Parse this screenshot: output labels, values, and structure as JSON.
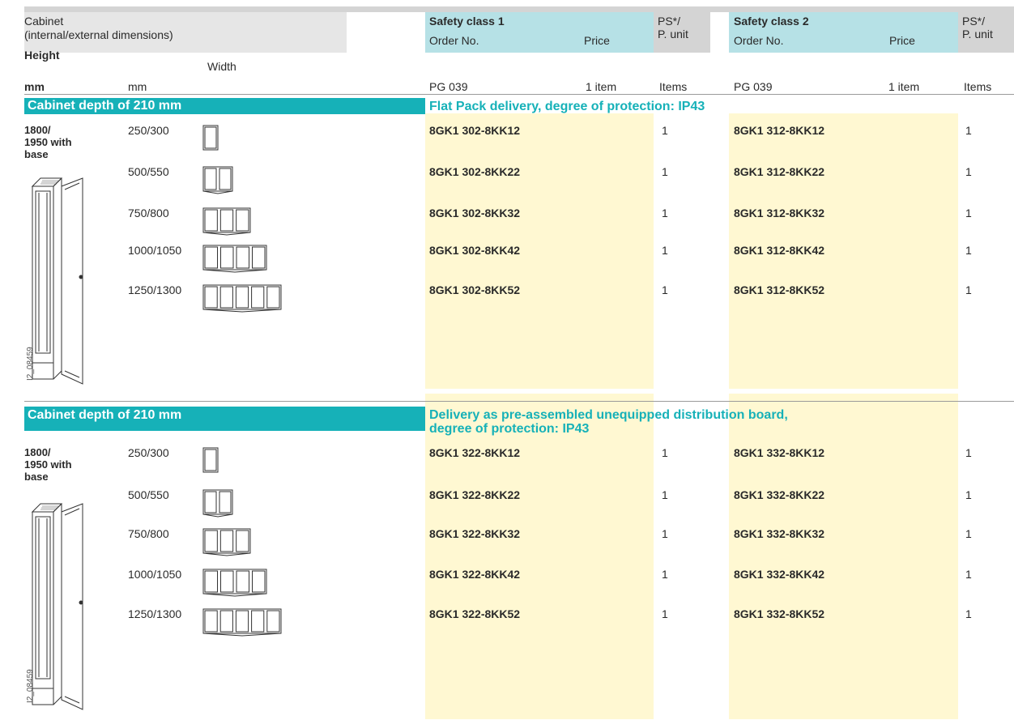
{
  "header": {
    "cabinet": "Cabinet",
    "dimensions": "(internal/external dimensions)",
    "height": "Height",
    "width": "Width",
    "mm1": "mm",
    "mm2": "mm",
    "safety1": "Safety class 1",
    "safety2": "Safety class 2",
    "order_no": "Order No.",
    "price": "Price",
    "ps": "PS*/",
    "punit": "P. unit",
    "pg": "PG 039",
    "item": "1 item",
    "items": "Items"
  },
  "sections": [
    {
      "title": "Cabinet depth of 210 mm",
      "delivery_line1": "Flat Pack delivery, degree of protection: IP43",
      "delivery_line2": "",
      "height_label": [
        "1800/",
        "1950 with",
        "base"
      ],
      "image_code": "I2_08459",
      "rows": [
        {
          "width": "250/300",
          "order1": "8GK1 302-8KK12",
          "ps1": "1",
          "order2": "8GK1 312-8KK12",
          "ps2": "1"
        },
        {
          "width": "500/550",
          "order1": "8GK1 302-8KK22",
          "ps1": "1",
          "order2": "8GK1 312-8KK22",
          "ps2": "1"
        },
        {
          "width": "750/800",
          "order1": "8GK1 302-8KK32",
          "ps1": "1",
          "order2": "8GK1 312-8KK32",
          "ps2": "1"
        },
        {
          "width": "1000/1050",
          "order1": "8GK1 302-8KK42",
          "ps1": "1",
          "order2": "8GK1 312-8KK42",
          "ps2": "1"
        },
        {
          "width": "1250/1300",
          "order1": "8GK1 302-8KK52",
          "ps1": "1",
          "order2": "8GK1 312-8KK52",
          "ps2": "1"
        }
      ]
    },
    {
      "title": "Cabinet depth of 210 mm",
      "delivery_line1": "Delivery as pre-assembled unequipped distribution board,",
      "delivery_line2": "degree of protection: IP43",
      "height_label": [
        "1800/",
        "1950 with",
        "base"
      ],
      "image_code": "I2_08459",
      "rows": [
        {
          "width": "250/300",
          "order1": "8GK1 322-8KK12",
          "ps1": "1",
          "order2": "8GK1 332-8KK12",
          "ps2": "1"
        },
        {
          "width": "500/550",
          "order1": "8GK1 322-8KK22",
          "ps1": "1",
          "order2": "8GK1 332-8KK22",
          "ps2": "1"
        },
        {
          "width": "750/800",
          "order1": "8GK1 322-8KK32",
          "ps1": "1",
          "order2": "8GK1 332-8KK32",
          "ps2": "1"
        },
        {
          "width": "1000/1050",
          "order1": "8GK1 322-8KK42",
          "ps1": "1",
          "order2": "8GK1 332-8KK42",
          "ps2": "1"
        },
        {
          "width": "1250/1300",
          "order1": "8GK1 322-8KK52",
          "ps1": "1",
          "order2": "8GK1 332-8KK52",
          "ps2": "1"
        }
      ]
    }
  ],
  "colors": {
    "teal": "#16b1b8",
    "header_blue": "#b6e1e6",
    "header_gray": "#e6e6e6",
    "ps_gray": "#d4d4d4",
    "column_yellow": "#fff8d2"
  }
}
